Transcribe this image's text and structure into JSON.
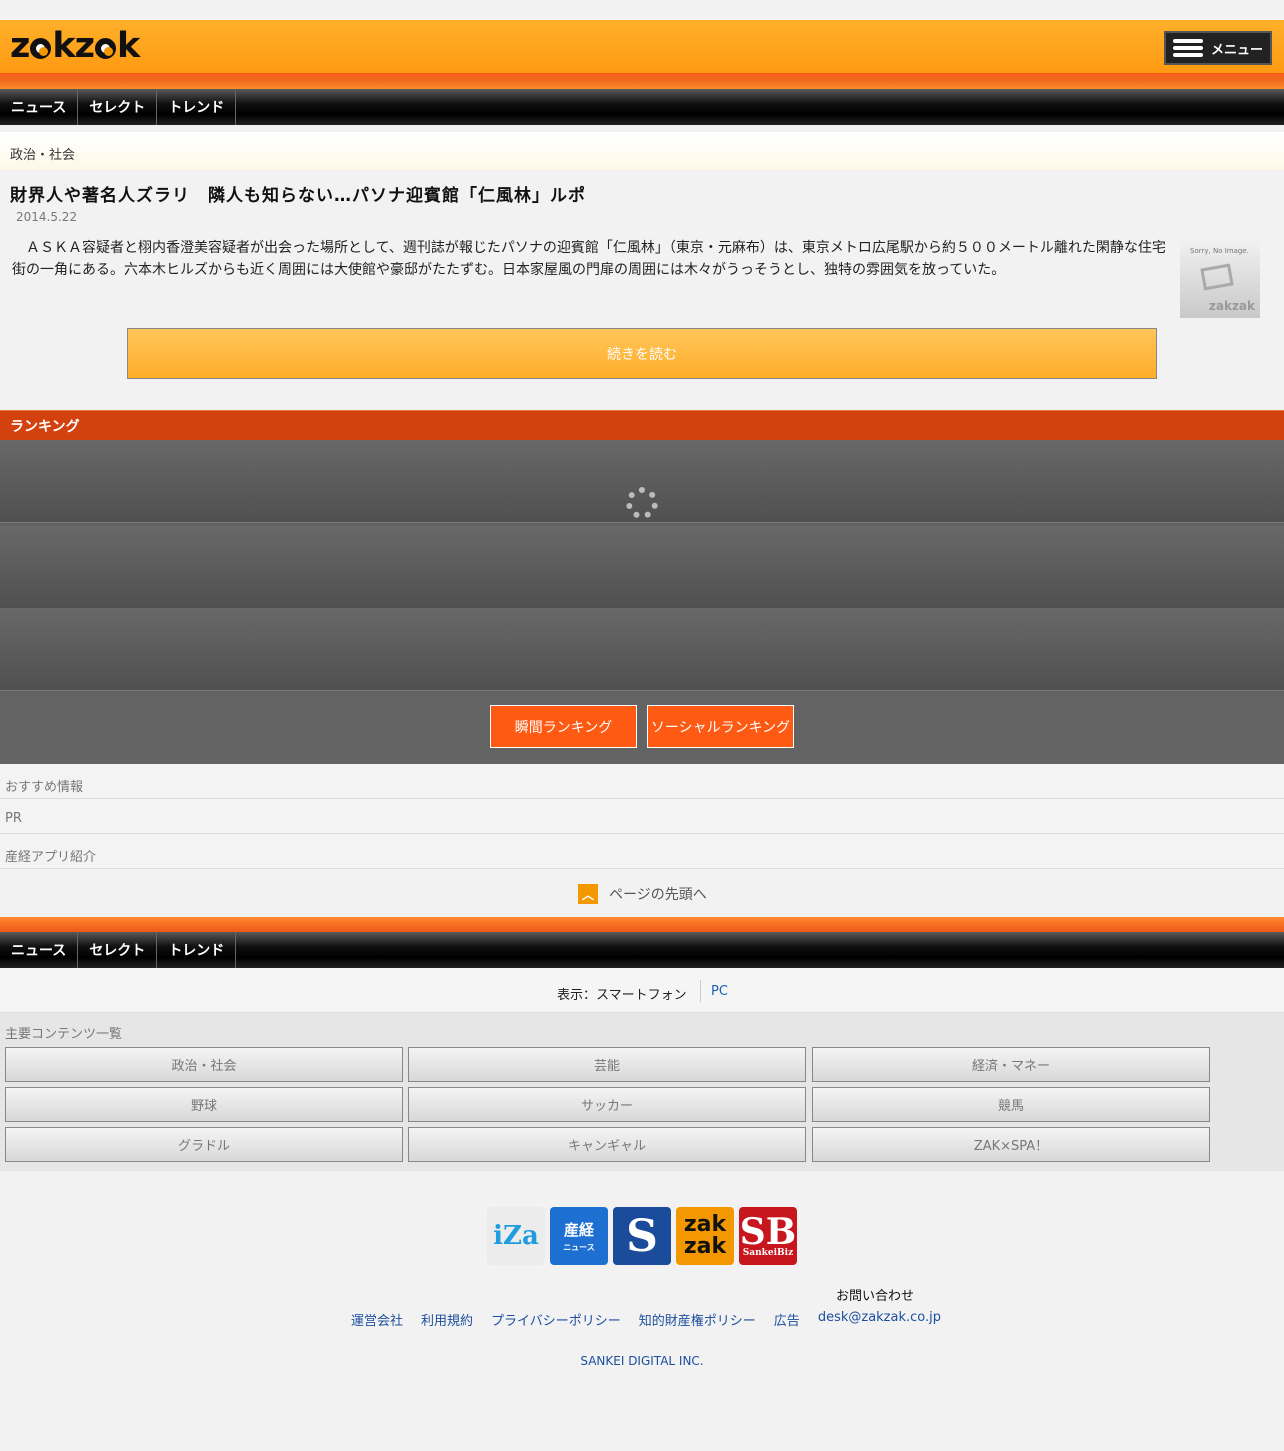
{
  "header": {
    "logo_text": "zakzak",
    "menu_label": "メニュー"
  },
  "nav": {
    "items": [
      "ニュース",
      "セレクト",
      "トレンド"
    ]
  },
  "article": {
    "category": "政治・社会",
    "title": "財界人や著名人ズラリ　隣人も知らない…パソナ迎賓館「仁風林」ルポ",
    "date": "2014.5.22",
    "body": "ＡＳＫＡ容疑者と栩内香澄美容疑者が出会った場所として、週刊誌が報じたパソナの迎賓館「仁風林」（東京・元麻布）は、東京メトロ広尾駅から約５００メートル離れた閑静な住宅街の一角にある。六本木ヒルズからも近く周囲には大使館や豪邸がたたずむ。日本家屋風の門扉の周囲には木々がうっそうとし、独特の雰囲気を放っていた。",
    "noimage_text": "Sorry, No Image.",
    "noimage_brand": "zakzak",
    "read_more": "続きを読む"
  },
  "ranking": {
    "heading": "ランキング",
    "btn_instant": "瞬間ランキング",
    "btn_social": "ソーシャルランキング"
  },
  "sections": {
    "recommend": "おすすめ情報",
    "pr": "PR",
    "apps": "産経アプリ紹介"
  },
  "to_top": "ページの先頭へ",
  "display": {
    "label": "表示：スマートフォン",
    "pc": "PC"
  },
  "contents": {
    "title": "主要コンテンツ一覧",
    "buttons": [
      "政治・社会",
      "芸能",
      "経済・マネー",
      "野球",
      "サッカー",
      "競馬",
      "グラドル",
      "キャンギャル",
      "ZAK×SPA！"
    ]
  },
  "logos": {
    "iza": "iZa",
    "sankei": "産経",
    "sankei_sub": "ニュース",
    "sanspo": "S",
    "zak1": "zak",
    "zak2": "zak",
    "sb": "SB",
    "sb_sub": "SankeiBiz"
  },
  "footer": {
    "contact": "お問い合わせ",
    "links": [
      "運営会社",
      "利用規約",
      "プライバシーポリシー",
      "知的財産権ポリシー",
      "広告",
      "desk@zakzak.co.jp"
    ],
    "corp": "SANKEI DIGITAL INC."
  },
  "colors": {
    "header_orange": "#ff9a12",
    "ranking_red": "#d2410e",
    "button_orange": "#ff5a14",
    "link_blue": "#1b4e9e"
  }
}
